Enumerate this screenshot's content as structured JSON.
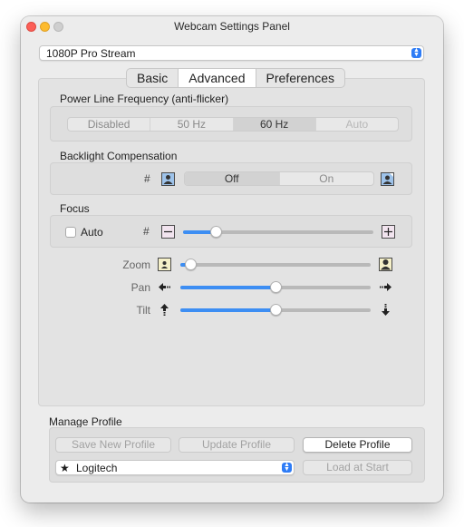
{
  "window": {
    "title": "Webcam Settings Panel"
  },
  "device_selector": {
    "value": "1080P Pro Stream"
  },
  "tabs": [
    {
      "label": "Basic",
      "selected": false
    },
    {
      "label": "Advanced",
      "selected": true
    },
    {
      "label": "Preferences",
      "selected": false
    }
  ],
  "power_line": {
    "label": "Power Line Frequency (anti-flicker)",
    "options": [
      "Disabled",
      "50 Hz",
      "60 Hz",
      "Auto"
    ],
    "selected": "60 Hz"
  },
  "backlight": {
    "label": "Backlight Compensation",
    "hash": "#",
    "options": [
      "Off",
      "On"
    ],
    "selected": "Off"
  },
  "focus": {
    "label": "Focus",
    "auto_label": "Auto",
    "auto_checked": false,
    "hash": "#",
    "value": 0.17
  },
  "zoom": {
    "label": "Zoom",
    "value": 0.05
  },
  "pan": {
    "label": "Pan",
    "value": 0.5
  },
  "tilt": {
    "label": "Tilt",
    "value": 0.5
  },
  "manage_profile": {
    "label": "Manage Profile",
    "save_new": "Save New Profile",
    "update": "Update Profile",
    "delete": "Delete Profile",
    "profile_value": "Logitech",
    "load_at_start": "Load at Start"
  },
  "colors": {
    "accent": "#3d8ef3",
    "icon_border": "#4a4a4a",
    "icon_fill": "#9ec3ea"
  }
}
